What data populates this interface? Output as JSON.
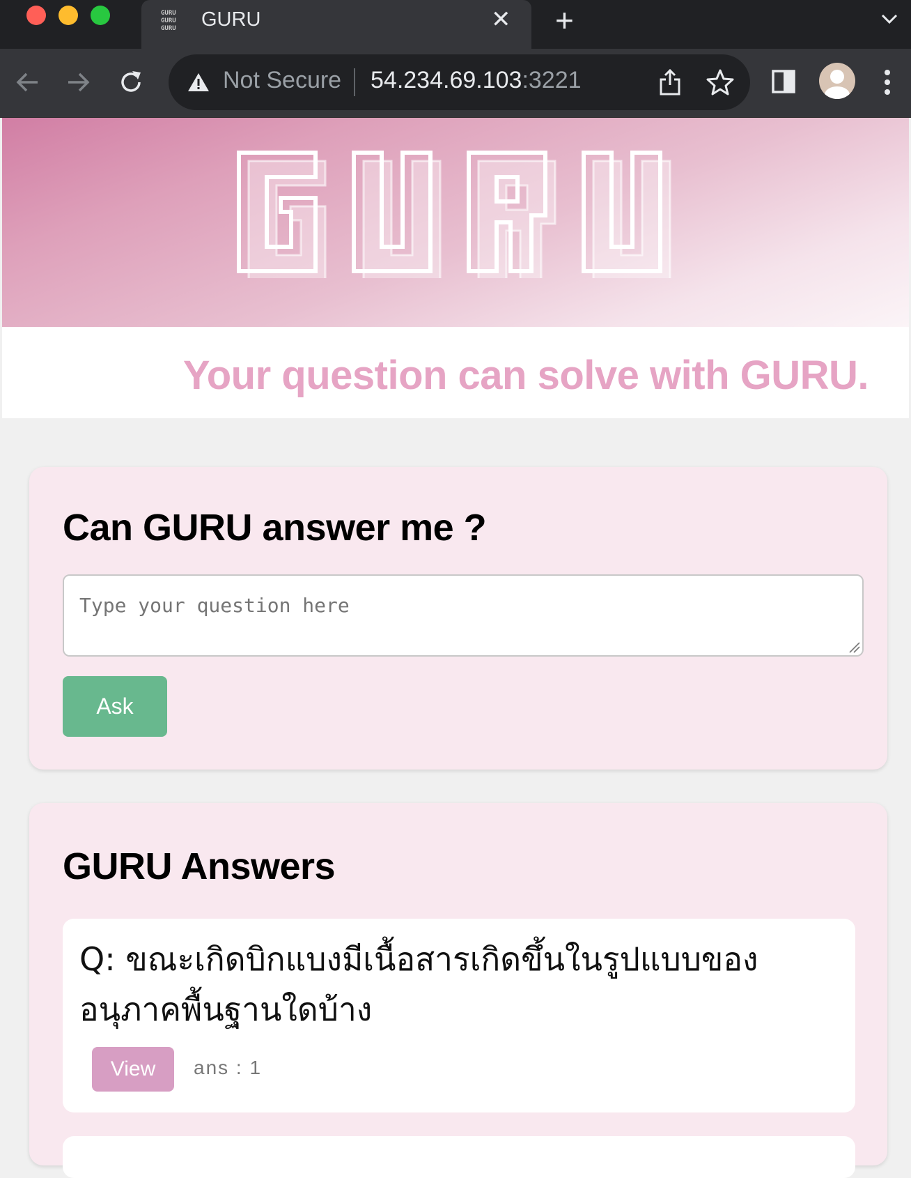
{
  "browser": {
    "tab_title": "GURU",
    "tab_favicon": "GURU\nGURU\nGURU",
    "close_glyph": "✕",
    "new_tab_glyph": "+",
    "security_label": "Not Secure",
    "url_host": "54.234.69.103",
    "url_port": ":3221"
  },
  "hero": {
    "logo_text": "GURU",
    "tagline": "Your question can solve with GURU."
  },
  "ask": {
    "heading": "Can GURU answer me ?",
    "placeholder": "Type your question here",
    "button_label": "Ask"
  },
  "answers": {
    "heading": "GURU Answers",
    "items": [
      {
        "question": "Q: ขณะเกิดบิกแบงมีเนื้อสารเกิดขึ้นในรูปแบบของอนุภาคพื้นฐานใดบ้าง",
        "view_label": "View",
        "count_label": "ans : 1"
      }
    ]
  },
  "colors": {
    "brand_pink": "#e6a4c4",
    "ask_button": "#68b88e",
    "view_button": "#d79ec3",
    "card_background": "#f9e8ef"
  },
  "icons": [
    "back-arrow-icon",
    "forward-arrow-icon",
    "reload-icon",
    "warning-icon",
    "share-icon",
    "star-icon",
    "side-panel-icon",
    "profile-icon",
    "more-menu-icon",
    "tab-list-chevron-icon",
    "resize-grip-icon"
  ]
}
